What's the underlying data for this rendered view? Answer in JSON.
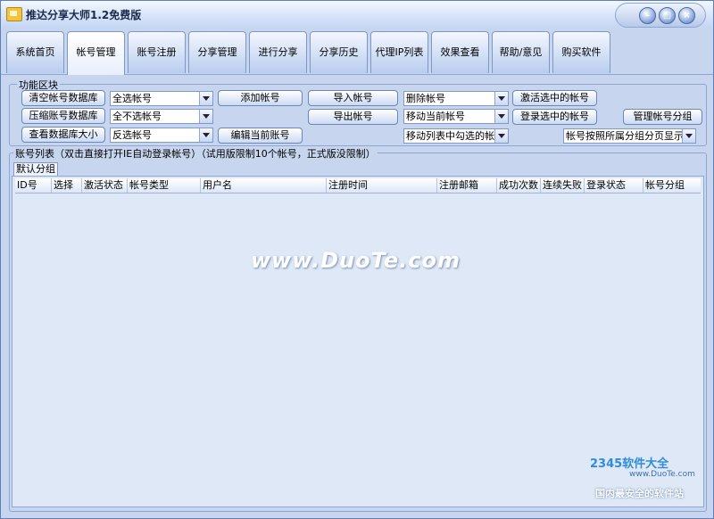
{
  "window": {
    "title": "推达分享大师1.2免费版",
    "controls": {
      "minimize": "–",
      "maximize": "▢",
      "close": "×"
    }
  },
  "tabs": [
    {
      "label": "系统首页",
      "active": false
    },
    {
      "label": "帐号管理",
      "active": true
    },
    {
      "label": "账号注册",
      "active": false
    },
    {
      "label": "分享管理",
      "active": false
    },
    {
      "label": "进行分享",
      "active": false
    },
    {
      "label": "分享历史",
      "active": false
    },
    {
      "label": "代理IP列表",
      "active": false
    },
    {
      "label": "效果查看",
      "active": false
    },
    {
      "label": "帮助/意见",
      "active": false
    },
    {
      "label": "购买软件",
      "active": false
    }
  ],
  "function_panel": {
    "legend": "功能区块",
    "buttons": {
      "clear_db": "清空帐号数据库",
      "compress_db": "压缩账号数据库",
      "view_db_size": "查看数据库大小",
      "add_account": "添加帐号",
      "edit_account": "编辑当前账号",
      "import": "导入帐号",
      "export": "导出帐号",
      "activate_selected": "激活选中的帐号",
      "login_selected": "登录选中的帐号",
      "manage_groups": "管理帐号分组"
    },
    "selects": {
      "select_all": "全选帐号",
      "select_none": "全不选帐号",
      "invert": "反选帐号",
      "delete": "删除帐号",
      "move_current": "移动当前帐号",
      "move_checked": "移动列表中勾选的帐",
      "group_paging": "帐号按照所属分组分页显示"
    }
  },
  "account_list": {
    "legend": "账号列表（双击直接打开IE自动登录帐号）（试用版限制10个帐号，正式版没限制）",
    "group_tab": "默认分组",
    "columns": [
      "ID号",
      "选择",
      "激活状态",
      "帐号类型",
      "用户名",
      "注册时间",
      "注册邮箱",
      "成功次数",
      "连续失败",
      "登录状态",
      "帐号分组"
    ],
    "rows": []
  },
  "watermarks": {
    "center": "www.DuoTe.com",
    "corner_logo": "2345软件大全",
    "corner_url": "www.DuoTe.com",
    "corner_slogan": "国内最安全的软件站"
  }
}
